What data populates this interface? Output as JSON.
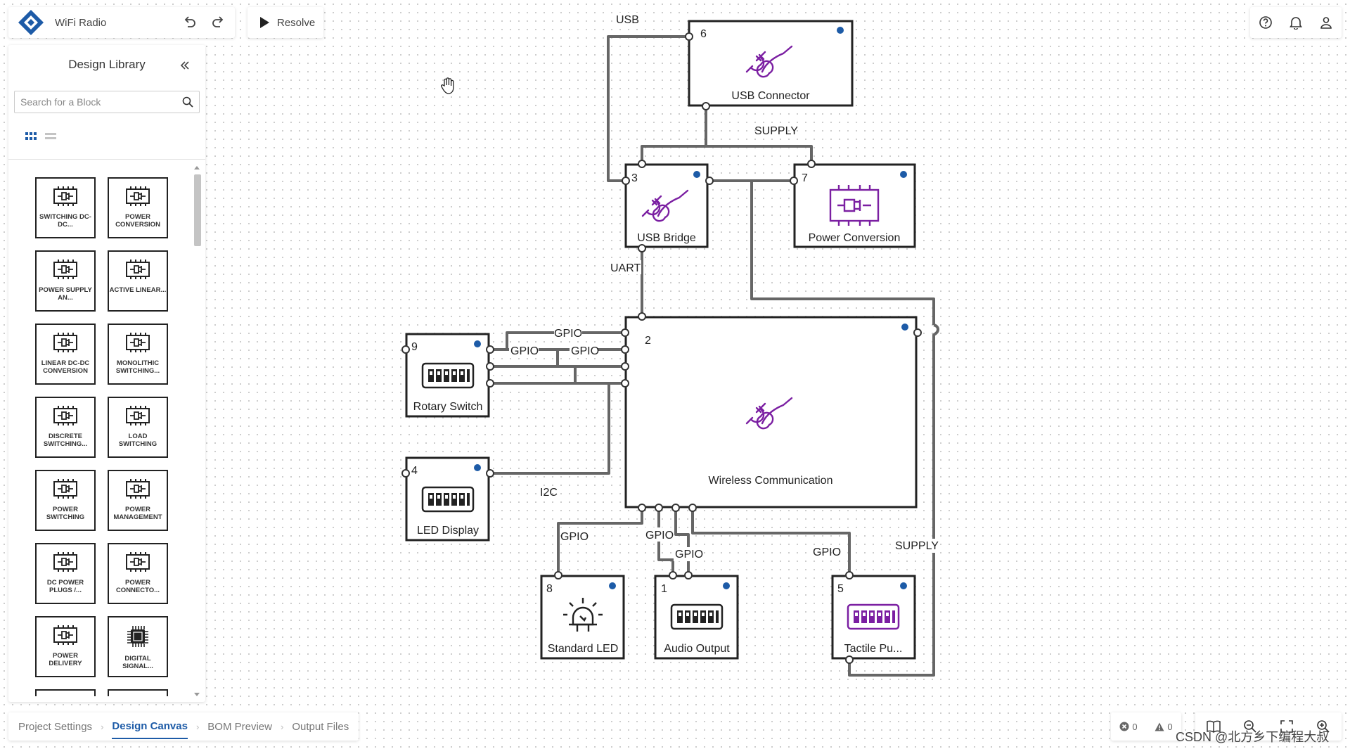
{
  "app": {
    "project_title": "WiFi Radio",
    "resolve_label": "Resolve",
    "colors": {
      "accent": "#1d5ba7",
      "block_icon": "#7b1fa2",
      "wire": "#666666",
      "dot": "#1d5ba7"
    }
  },
  "sidebar": {
    "title": "Design Library",
    "search_placeholder": "Search for a Block",
    "items": [
      {
        "label": "SWITCHING DC-DC...",
        "icon": "chip-connector-icon"
      },
      {
        "label": "POWER CONVERSION",
        "icon": "chip-connector-icon"
      },
      {
        "label": "POWER SUPPLY AN...",
        "icon": "chip-connector-icon"
      },
      {
        "label": "ACTIVE LINEAR...",
        "icon": "chip-connector-icon"
      },
      {
        "label": "LINEAR DC-DC CONVERSION",
        "icon": "chip-connector-icon"
      },
      {
        "label": "MONOLITHIC SWITCHING...",
        "icon": "chip-connector-icon"
      },
      {
        "label": "DISCRETE SWITCHING...",
        "icon": "chip-connector-icon"
      },
      {
        "label": "LOAD SWITCHING",
        "icon": "chip-connector-icon"
      },
      {
        "label": "POWER SWITCHING",
        "icon": "chip-connector-icon"
      },
      {
        "label": "POWER MANAGEMENT",
        "icon": "chip-connector-icon"
      },
      {
        "label": "DC POWER PLUGS /...",
        "icon": "chip-connector-icon"
      },
      {
        "label": "POWER CONNECTO...",
        "icon": "chip-connector-icon"
      },
      {
        "label": "POWER DELIVERY",
        "icon": "chip-connector-icon"
      },
      {
        "label": "DIGITAL SIGNAL...",
        "icon": "microchip-icon"
      },
      {
        "label": "",
        "icon": "chip-connector-icon"
      },
      {
        "label": "",
        "icon": "chip-connector-icon"
      }
    ]
  },
  "tabs": [
    {
      "label": "Project Settings",
      "active": false
    },
    {
      "label": "Design Canvas",
      "active": true
    },
    {
      "label": "BOM Preview",
      "active": false
    },
    {
      "label": "Output Files",
      "active": false
    }
  ],
  "status": {
    "errors": "0",
    "warnings": "0"
  },
  "watermark": "CSDN @北方乡下编程大叔",
  "canvas": {
    "blocks": [
      {
        "id": "usb-connector",
        "number": "6",
        "label": "USB Connector",
        "icon": "usb-plug-icon"
      },
      {
        "id": "usb-bridge",
        "number": "3",
        "label": "USB Bridge",
        "icon": "usb-plug-icon"
      },
      {
        "id": "power-conversion",
        "number": "7",
        "label": "Power Conversion",
        "icon": "power-chip-icon"
      },
      {
        "id": "wireless-communication",
        "number": "2",
        "label": "Wireless Communication",
        "icon": "usb-plug-icon"
      },
      {
        "id": "rotary-switch",
        "number": "9",
        "label": "Rotary Switch",
        "icon": "dip-switch-icon"
      },
      {
        "id": "led-display",
        "number": "4",
        "label": "LED Display",
        "icon": "dip-switch-icon"
      },
      {
        "id": "standard-led",
        "number": "8",
        "label": "Standard LED",
        "icon": "led-icon"
      },
      {
        "id": "audio-output",
        "number": "1",
        "label": "Audio Output",
        "icon": "dip-switch-icon"
      },
      {
        "id": "tactile-push",
        "number": "5",
        "label": "Tactile Pu...",
        "icon": "dip-switch-purple-icon"
      }
    ],
    "nets": [
      {
        "id": "usb",
        "label": "USB"
      },
      {
        "id": "supply-top",
        "label": "SUPPLY"
      },
      {
        "id": "uart",
        "label": "UART"
      },
      {
        "id": "gpio-a",
        "label": "GPIO"
      },
      {
        "id": "gpio-b",
        "label": "GPIO"
      },
      {
        "id": "gpio-c",
        "label": "GPIO"
      },
      {
        "id": "i2c",
        "label": "I2C"
      },
      {
        "id": "gpio-led",
        "label": "GPIO"
      },
      {
        "id": "gpio-audio-1",
        "label": "GPIO"
      },
      {
        "id": "gpio-audio-2",
        "label": "GPIO"
      },
      {
        "id": "gpio-tactile",
        "label": "GPIO"
      },
      {
        "id": "supply-right",
        "label": "SUPPLY"
      }
    ]
  }
}
